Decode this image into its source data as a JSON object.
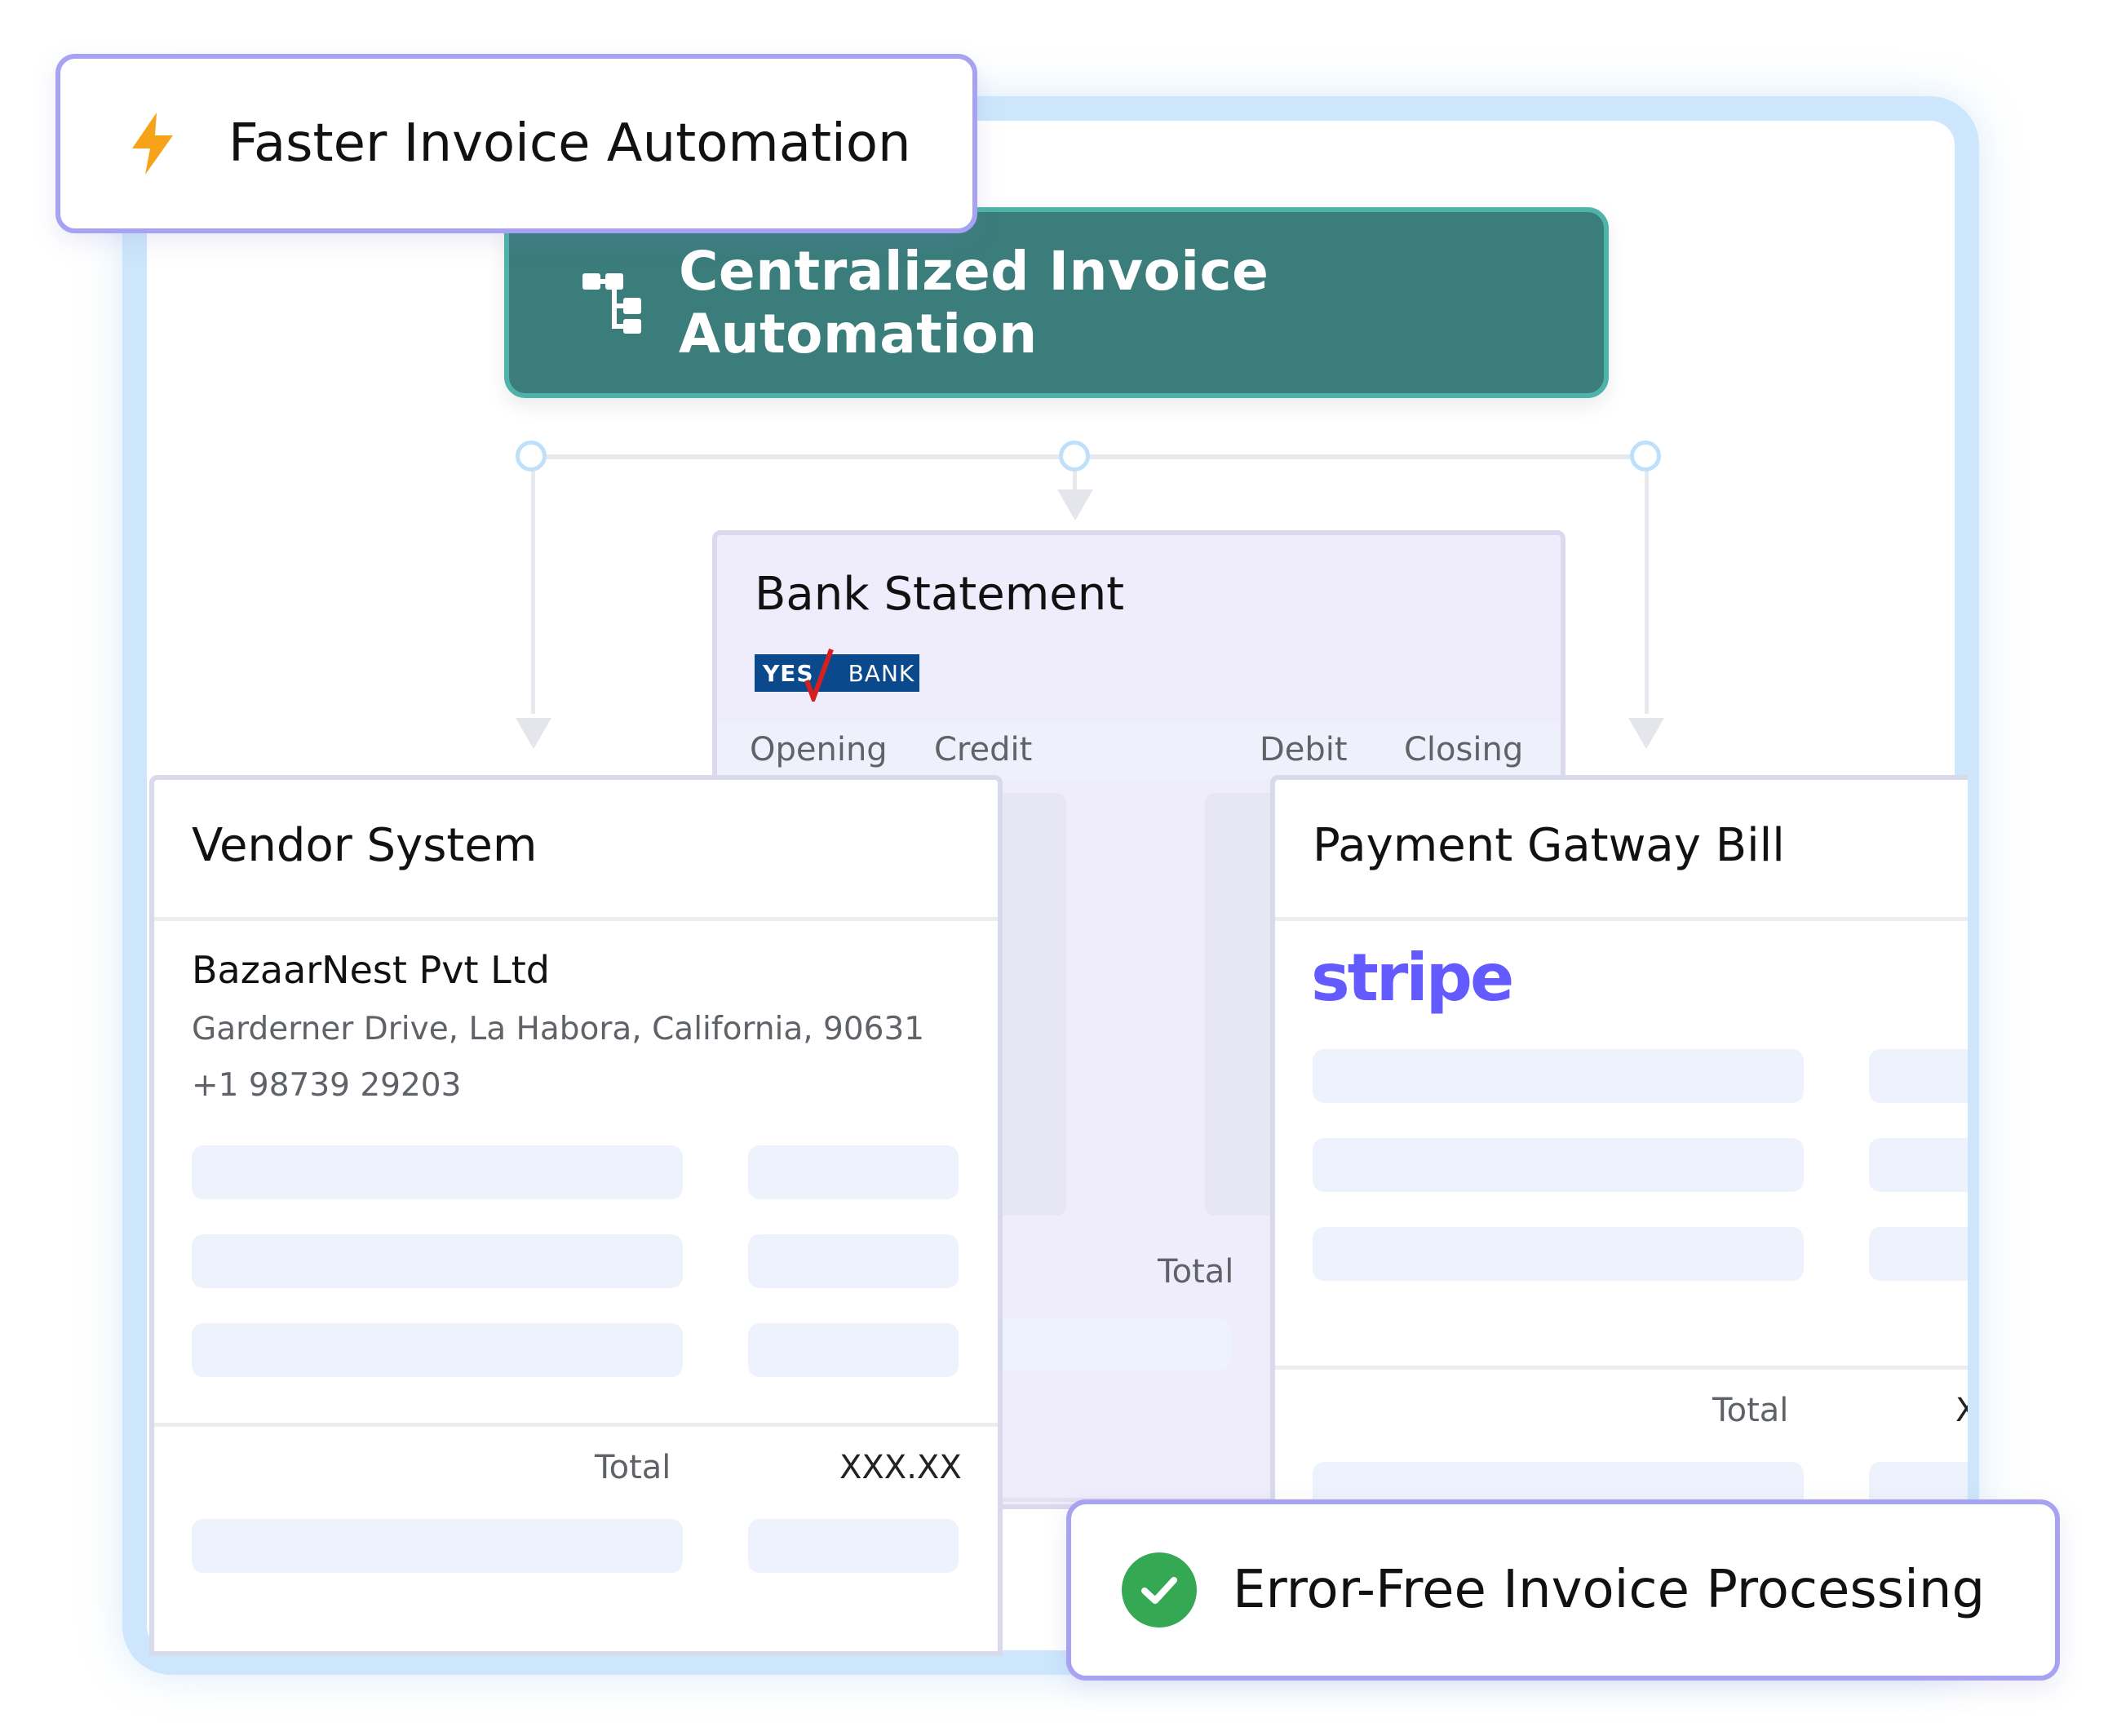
{
  "badges": {
    "faster": "Faster Invoice Automation",
    "error_free": "Error-Free Invoice Processing"
  },
  "central": {
    "label": "Centralized Invoice Automation",
    "icon": "hierarchy-icon"
  },
  "bank": {
    "title": "Bank Statement",
    "logo_yes": "YES",
    "logo_bank": "BANK",
    "columns": [
      "Opening",
      "Credit",
      "Debit",
      "Closing"
    ],
    "total_label": "Total"
  },
  "vendor": {
    "title": "Vendor System",
    "company": "BazaarNest Pvt Ltd",
    "address": "Garderner Drive, La Habora, California, 90631",
    "phone": "+1 98739 29203",
    "total_label": "Total",
    "total_value": "XXX.XX"
  },
  "payment": {
    "title": "Payment Gatway Bill",
    "logo": "stripe",
    "total_label": "Total",
    "total_value_fragment": "X"
  },
  "colors": {
    "teal": "#3a7d7b",
    "teal_border": "#4fb3aa",
    "badge_border": "#a7a2f1",
    "bank_bg": "#efecfb",
    "stripe": "#635bff",
    "yesbank": "#0a4a8c",
    "check_green": "#34a853",
    "bolt_orange": "#f6a31a",
    "frame": "#cde6fb"
  }
}
